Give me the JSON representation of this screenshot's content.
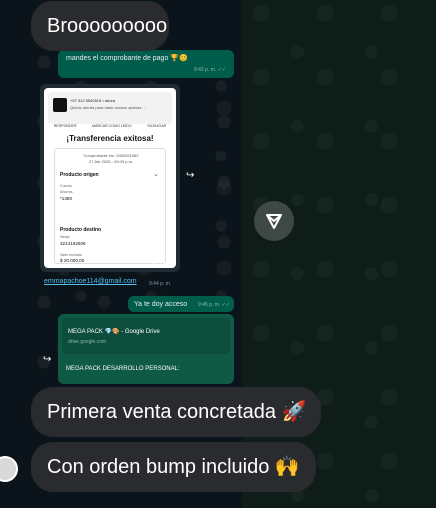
{
  "overlay_bubbles": {
    "first": "Brooooooooo",
    "second": "Primera venta concretada 🚀",
    "third": "Con orden bump incluido 🙌"
  },
  "chat": {
    "msg1": {
      "text": "mandes el comprobante de pago 🏆😊",
      "time": "9:43 p. m. ✓✓"
    },
    "image": {
      "notification": {
        "line1": "+57 312 5540519 • ahora",
        "line2": "Quedo atenta para darle acceso apenas ..."
      },
      "actions": [
        "RESPONDER",
        "MARCAR COMO LEÍDO",
        "SILENCIAR"
      ],
      "title": "¡Transferencia exitosa!",
      "comprobante": "Comprobante No. 0000091982",
      "date": "27 Abr 2025 - 09:43 p.m.",
      "origen_label": "Producto origen",
      "cuenta_label": "Cuenta",
      "ahorros_label": "Ahorros",
      "ahorros_value": "*1380",
      "destino_label": "Producto destino",
      "nequi_label": "Nequi",
      "nequi_value": "3214162606",
      "valor_label": "Valor enviado",
      "valor_value": "$ 20.000,00",
      "time": "9:44 p. m."
    },
    "email": {
      "text": "emmapachoe114@gmail.com",
      "time": "9:44 p. m."
    },
    "msg2": {
      "text": "Ya te doy acceso",
      "time": "9:45 p. m. ✓✓"
    },
    "msg3": {
      "card_title": "MEGA PACK 💎🎨 - Google Drive",
      "card_url": "drive.google.com",
      "body": "MEGA PACK DESARROLLO PERSONAL:"
    }
  }
}
